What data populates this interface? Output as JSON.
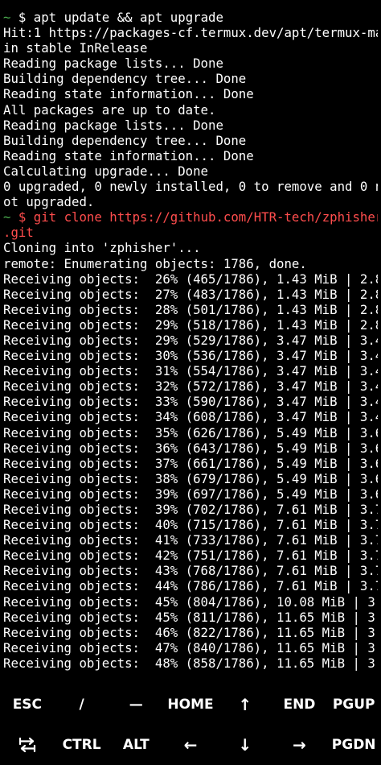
{
  "colors": {
    "background": "#000000",
    "text": "#ffffff",
    "prompt_tilde": "#4caf50",
    "command_highlight": "#ff4d4d"
  },
  "terminal": {
    "prompt_symbol": "~",
    "prompt_dollar": " $ ",
    "command1": "apt update && apt upgrade",
    "output1": [
      "Hit:1 https://packages-cf.termux.dev/apt/termux-ma",
      "in stable InRelease",
      "Reading package lists... Done",
      "Building dependency tree... Done",
      "Reading state information... Done",
      "All packages are up to date.",
      "Reading package lists... Done",
      "Building dependency tree... Done",
      "Reading state information... Done",
      "Calculating upgrade... Done",
      "0 upgraded, 0 newly installed, 0 to remove and 0 n",
      "ot upgraded."
    ],
    "command2_line1": "git clone https://github.com/HTR-tech/zphisher",
    "command2_line2": ".git",
    "output2": [
      "Cloning into 'zphisher'...",
      "remote: Enumerating objects: 1786, done.",
      "Receiving objects:  26% (465/1786), 1.43 MiB | 2.8",
      "Receiving objects:  27% (483/1786), 1.43 MiB | 2.8",
      "Receiving objects:  28% (501/1786), 1.43 MiB | 2.8",
      "Receiving objects:  29% (518/1786), 1.43 MiB | 2.8",
      "Receiving objects:  29% (529/1786), 3.47 MiB | 3.4",
      "Receiving objects:  30% (536/1786), 3.47 MiB | 3.4",
      "Receiving objects:  31% (554/1786), 3.47 MiB | 3.4",
      "Receiving objects:  32% (572/1786), 3.47 MiB | 3.4",
      "Receiving objects:  33% (590/1786), 3.47 MiB | 3.4",
      "Receiving objects:  34% (608/1786), 3.47 MiB | 3.4",
      "Receiving objects:  35% (626/1786), 5.49 MiB | 3.6",
      "Receiving objects:  36% (643/1786), 5.49 MiB | 3.6",
      "Receiving objects:  37% (661/1786), 5.49 MiB | 3.6",
      "Receiving objects:  38% (679/1786), 5.49 MiB | 3.6",
      "Receiving objects:  39% (697/1786), 5.49 MiB | 3.6",
      "Receiving objects:  39% (702/1786), 7.61 MiB | 3.7",
      "Receiving objects:  40% (715/1786), 7.61 MiB | 3.7",
      "Receiving objects:  41% (733/1786), 7.61 MiB | 3.7",
      "Receiving objects:  42% (751/1786), 7.61 MiB | 3.7",
      "Receiving objects:  43% (768/1786), 7.61 MiB | 3.7",
      "Receiving objects:  44% (786/1786), 7.61 MiB | 3.7",
      "Receiving objects:  45% (804/1786), 10.08 MiB | 3.",
      "Receiving objects:  45% (811/1786), 11.65 MiB | 3.",
      "Receiving objects:  46% (822/1786), 11.65 MiB | 3.",
      "Receiving objects:  47% (840/1786), 11.65 MiB | 3.",
      "Receiving objects:  48% (858/1786), 11.65 MiB | 3."
    ]
  },
  "extra_keys": {
    "row1": [
      {
        "label": "ESC",
        "icon": ""
      },
      {
        "label": "/",
        "icon": ""
      },
      {
        "label": "—",
        "icon": ""
      },
      {
        "label": "HOME",
        "icon": ""
      },
      {
        "label": "↑",
        "icon": "arrow-up-icon"
      },
      {
        "label": "END",
        "icon": ""
      },
      {
        "label": "PGUP",
        "icon": ""
      }
    ],
    "row2": [
      {
        "label": "",
        "icon": "tab-icon"
      },
      {
        "label": "CTRL",
        "icon": ""
      },
      {
        "label": "ALT",
        "icon": ""
      },
      {
        "label": "←",
        "icon": "arrow-left-icon"
      },
      {
        "label": "↓",
        "icon": "arrow-down-icon"
      },
      {
        "label": "→",
        "icon": "arrow-right-icon"
      },
      {
        "label": "PGDN",
        "icon": ""
      }
    ]
  }
}
